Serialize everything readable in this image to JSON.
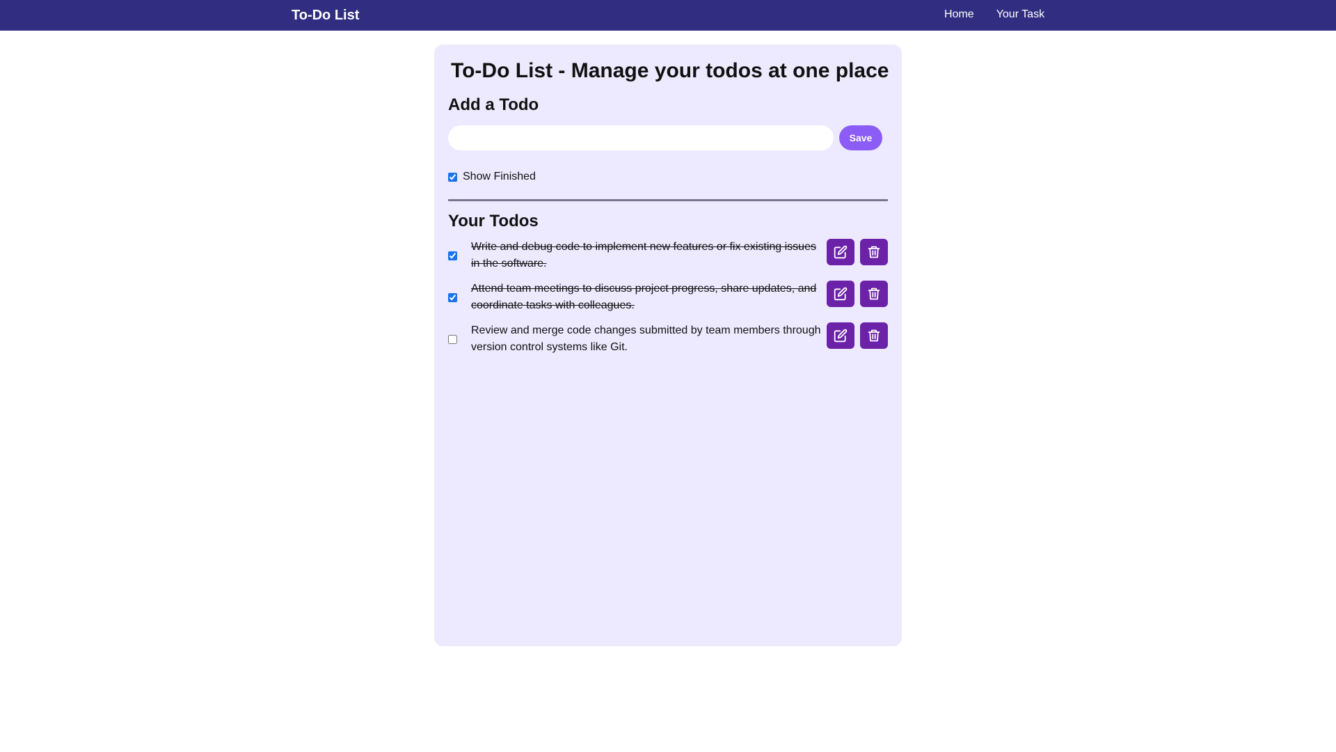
{
  "navbar": {
    "brand": "To-Do List",
    "links": [
      "Home",
      "Your Task"
    ]
  },
  "main": {
    "title": "To-Do List - Manage your todos at one place",
    "add_heading": "Add a Todo",
    "input": {
      "value": "",
      "placeholder": ""
    },
    "save_label": "Save",
    "show_finished": {
      "label": "Show Finished",
      "checked": true
    },
    "todos_heading": "Your Todos",
    "todos": [
      {
        "text": "Write and debug code to implement new features or fix existing issues in the software.",
        "completed": true
      },
      {
        "text": "Attend team meetings to discuss project progress, share updates, and coordinate tasks with colleagues.",
        "completed": true
      },
      {
        "text": "Review and merge code changes submitted by team members through version control systems like Git.",
        "completed": false
      }
    ]
  },
  "icons": {
    "edit": "edit-icon",
    "delete": "trash-icon"
  },
  "colors": {
    "navbar": "#312e81",
    "card": "#ede9fe",
    "save_button": "#8b5cf6",
    "action_button": "#6b21a8"
  }
}
